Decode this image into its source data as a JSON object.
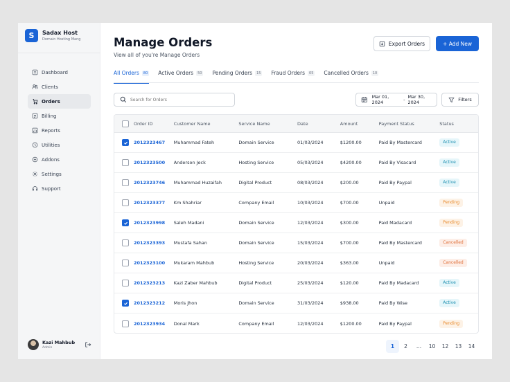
{
  "brand": {
    "logo_glyph": "S",
    "name": "Sadax Host",
    "subtitle": "Domain Hosting Mang"
  },
  "sidebar": {
    "items": [
      {
        "label": "Dashboard",
        "icon": "dashboard-icon"
      },
      {
        "label": "Clients",
        "icon": "users-icon"
      },
      {
        "label": "Orders",
        "icon": "orders-icon",
        "active": true
      },
      {
        "label": "Billing",
        "icon": "billing-icon"
      },
      {
        "label": "Reports",
        "icon": "reports-icon"
      },
      {
        "label": "Utilities",
        "icon": "utilities-icon"
      },
      {
        "label": "Addons",
        "icon": "addons-icon"
      },
      {
        "label": "Settings",
        "icon": "gear-icon"
      },
      {
        "label": "Support",
        "icon": "headset-icon"
      }
    ]
  },
  "user": {
    "name": "Kazi Mahbub",
    "role": "Admin"
  },
  "header": {
    "title": "Manage Orders",
    "subtitle": "View all of you're Manage Orders",
    "export_label": "Export Orders",
    "new_label": "+ Add New"
  },
  "tabs": [
    {
      "label": "All Orders",
      "count": "80",
      "active": true
    },
    {
      "label": "Active Orders",
      "count": "50"
    },
    {
      "label": "Pending Orders",
      "count": "15"
    },
    {
      "label": "Fraud Orders",
      "count": "05"
    },
    {
      "label": "Cancelled Orders",
      "count": "10"
    }
  ],
  "toolbar": {
    "search_placeholder": "Search for Orders",
    "date_start": "Mar 01, 2024",
    "date_sep": "-",
    "date_end": "Mar 30, 2024",
    "filters_label": "Filters"
  },
  "table": {
    "columns": [
      "Order ID",
      "Customer Name",
      "Service Name",
      "Date",
      "Amount",
      "Payment Status",
      "Status"
    ],
    "rows": [
      {
        "checked": true,
        "id": "2012323467",
        "customer": "Muhammad Fateh",
        "service": "Domain Service",
        "date": "01/03/2024",
        "amount": "$1200.00",
        "payment": "Paid By Mastercard",
        "status": "Active"
      },
      {
        "checked": false,
        "id": "2012323500",
        "customer": "Anderson Jeck",
        "service": "Hosting Service",
        "date": "05/03/2024",
        "amount": "$4200.00",
        "payment": "Paid By Visacard",
        "status": "Active"
      },
      {
        "checked": false,
        "id": "2012323746",
        "customer": "Muhammad Huzaifah",
        "service": "Digital Product",
        "date": "08/03/2024",
        "amount": "$200.00",
        "payment": "Paid By Paypal",
        "status": "Active"
      },
      {
        "checked": false,
        "id": "2012323377",
        "customer": "Km Shahriar",
        "service": "Company Email",
        "date": "10/03/2024",
        "amount": "$700.00",
        "payment": "Unpaid",
        "status": "Pending"
      },
      {
        "checked": true,
        "id": "2012323998",
        "customer": "Saleh Madani",
        "service": "Domain Service",
        "date": "12/03/2024",
        "amount": "$300.00",
        "payment": "Paid Madacard",
        "status": "Pending"
      },
      {
        "checked": false,
        "id": "2012323393",
        "customer": "Mustafa Sahan",
        "service": "Domain Service",
        "date": "15/03/2024",
        "amount": "$700.00",
        "payment": "Paid By Mastercard",
        "status": "Cancelled"
      },
      {
        "checked": false,
        "id": "2012323100",
        "customer": "Mukaram Mahbub",
        "service": "Hosting Service",
        "date": "20/03/2024",
        "amount": "$363.00",
        "payment": "Unpaid",
        "status": "Cancelled"
      },
      {
        "checked": false,
        "id": "2012323213",
        "customer": "Kazi Zaber Mahbub",
        "service": "Digital Product",
        "date": "25/03/2024",
        "amount": "$120.00",
        "payment": "Paid By Madacard",
        "status": "Active"
      },
      {
        "checked": true,
        "id": "2012323212",
        "customer": "Moris Jhon",
        "service": "Domain Service",
        "date": "31/03/2024",
        "amount": "$938.00",
        "payment": "Paid By Wise",
        "status": "Active"
      },
      {
        "checked": false,
        "id": "2012323934",
        "customer": "Donal Mark",
        "service": "Company Email",
        "date": "12/03/2024",
        "amount": "$1200.00",
        "payment": "Paid By Paypal",
        "status": "Pending"
      }
    ]
  },
  "status_colors": {
    "Active": {
      "fg": "#1c8fb0",
      "bg": "#e6f6fa"
    },
    "Pending": {
      "fg": "#e8892a",
      "bg": "#fdf2e6"
    },
    "Cancelled": {
      "fg": "#e0713c",
      "bg": "#fdeee7"
    }
  },
  "pagination": {
    "pages": [
      "1",
      "2",
      "...",
      "10",
      "12",
      "13",
      "14"
    ],
    "current": "1"
  },
  "colors": {
    "accent": "#1a64d6"
  }
}
